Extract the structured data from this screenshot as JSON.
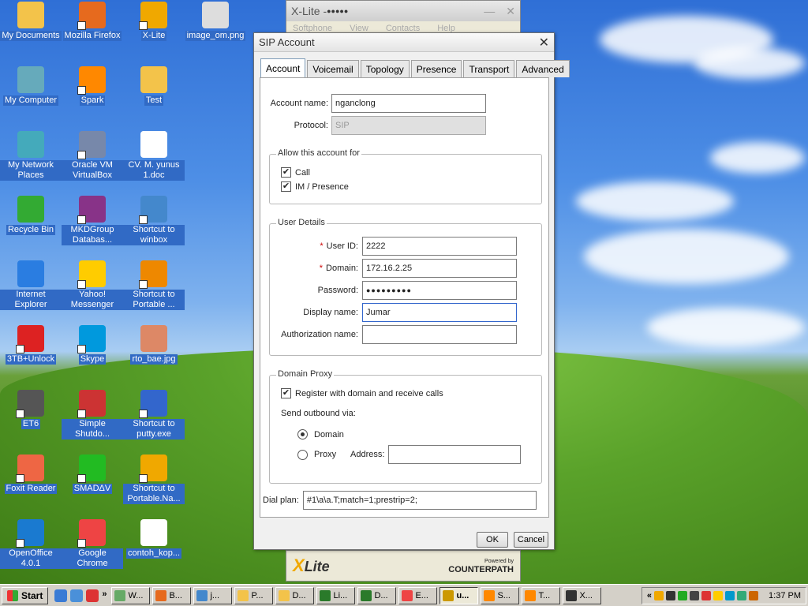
{
  "colors": {
    "xp_blue": "#316ac5",
    "required_star": "#cc0000"
  },
  "desktop": {
    "icons": [
      {
        "label": "My Documents",
        "icon": "folder-documents-icon",
        "shortcut": false
      },
      {
        "label": "Mozilla Firefox",
        "icon": "firefox-icon",
        "shortcut": true
      },
      {
        "label": "X-Lite",
        "icon": "xlite-icon",
        "shortcut": true
      },
      {
        "label": "image_om.png",
        "icon": "image-file-icon",
        "shortcut": false
      },
      {
        "label": "My Computer",
        "icon": "computer-icon",
        "shortcut": false
      },
      {
        "label": "Spark",
        "icon": "spark-icon",
        "shortcut": true
      },
      {
        "label": "Test",
        "icon": "folder-icon",
        "shortcut": false
      },
      {
        "label": "My Network Places",
        "icon": "network-places-icon",
        "shortcut": false
      },
      {
        "label": "Oracle VM VirtualBox",
        "icon": "virtualbox-icon",
        "shortcut": true
      },
      {
        "label": "CV. M. yunus 1.doc",
        "icon": "document-icon",
        "shortcut": false
      },
      {
        "label": "Recycle Bin",
        "icon": "recycle-bin-icon",
        "shortcut": false
      },
      {
        "label": "MKDGroup Databas...",
        "icon": "database-icon",
        "shortcut": true
      },
      {
        "label": "Shortcut to winbox",
        "icon": "winbox-icon",
        "shortcut": true
      },
      {
        "label": "Internet Explorer",
        "icon": "internet-explorer-icon",
        "shortcut": false
      },
      {
        "label": "Yahoo! Messenger",
        "icon": "yahoo-messenger-icon",
        "shortcut": true
      },
      {
        "label": "Shortcut to Portable ...",
        "icon": "portable-app-icon",
        "shortcut": true
      },
      {
        "label": "3TB+Unlock",
        "icon": "3tb-unlock-icon",
        "shortcut": true
      },
      {
        "label": "Skype",
        "icon": "skype-icon",
        "shortcut": true
      },
      {
        "label": "rto_bae.jpg",
        "icon": "image-file-icon",
        "shortcut": false
      },
      {
        "label": "ET6",
        "icon": "et6-icon",
        "shortcut": true
      },
      {
        "label": "Simple Shutdo...",
        "icon": "shutdown-icon",
        "shortcut": true
      },
      {
        "label": "Shortcut to putty.exe",
        "icon": "putty-icon",
        "shortcut": true
      },
      {
        "label": "Foxit Reader",
        "icon": "foxit-reader-icon",
        "shortcut": true
      },
      {
        "label": "SMADΔV",
        "icon": "smadav-icon",
        "shortcut": true
      },
      {
        "label": "Shortcut to Portable.Na...",
        "icon": "portable-app-icon",
        "shortcut": true
      },
      {
        "label": "OpenOffice 4.0.1",
        "icon": "openoffice-icon",
        "shortcut": true
      },
      {
        "label": "Google Chrome",
        "icon": "chrome-icon",
        "shortcut": true
      },
      {
        "label": "contoh_kop...",
        "icon": "text-file-icon",
        "shortcut": false
      }
    ]
  },
  "xlite_window": {
    "title": "X-Lite - ",
    "title_masked": "●●●●●",
    "menu": [
      "Softphone",
      "View",
      "Contacts",
      "Help"
    ],
    "logo_text": "Lite",
    "logo_x": "X",
    "powered_by": "Powered by",
    "brand": "COUNTERPATH"
  },
  "dialog": {
    "title": "SIP Account",
    "close_glyph": "✕",
    "tabs": [
      "Account",
      "Voicemail",
      "Topology",
      "Presence",
      "Transport",
      "Advanced"
    ],
    "active_tab": "Account",
    "account_name_label": "Account name:",
    "account_name_value": "nganclong",
    "protocol_label": "Protocol:",
    "protocol_value": "SIP",
    "allow_group": {
      "title": "Allow this account for",
      "call_label": "Call",
      "call_checked": true,
      "im_label": "IM / Presence",
      "im_checked": true
    },
    "user_details": {
      "title": "User Details",
      "required_mark": "*",
      "user_id_label": "User ID:",
      "user_id_value": "2222",
      "domain_label": "Domain:",
      "domain_value": "172.16.2.25",
      "password_label": "Password:",
      "password_value": "●●●●●●●●●",
      "display_name_label": "Display name:",
      "display_name_value": "Jumar",
      "auth_name_label": "Authorization name:",
      "auth_name_value": ""
    },
    "domain_proxy": {
      "title": "Domain Proxy",
      "register_label": "Register with domain and receive calls",
      "register_checked": true,
      "send_outbound_label": "Send outbound via:",
      "domain_radio_label": "Domain",
      "proxy_radio_label": "Proxy",
      "selected": "Domain",
      "address_label": "Address:",
      "address_value": ""
    },
    "dial_plan_label": "Dial plan:",
    "dial_plan_value": "#1\\a\\a.T;match=1;prestrip=2;",
    "check_glyph": "✔",
    "ok_label": "OK",
    "cancel_label": "Cancel"
  },
  "taskbar": {
    "start_label": "Start",
    "chevron": "»",
    "tasks": [
      {
        "label": "W...",
        "icon": "window-icon"
      },
      {
        "label": "B...",
        "icon": "firefox-icon"
      },
      {
        "label": "j...",
        "icon": "winbox-icon"
      },
      {
        "label": "P...",
        "icon": "folder-icon"
      },
      {
        "label": "D...",
        "icon": "folder-icon"
      },
      {
        "label": "Li...",
        "icon": "excel-icon"
      },
      {
        "label": "D...",
        "icon": "excel-icon"
      },
      {
        "label": "E...",
        "icon": "chrome-icon"
      },
      {
        "label": "u...",
        "icon": "app-icon"
      },
      {
        "label": "S...",
        "icon": "spark-icon"
      },
      {
        "label": "T...",
        "icon": "spark-icon"
      },
      {
        "label": "X...",
        "icon": "xlite-icon"
      }
    ],
    "active_task_index": 8,
    "tray_chevron": "«",
    "clock": "1:37 PM"
  }
}
